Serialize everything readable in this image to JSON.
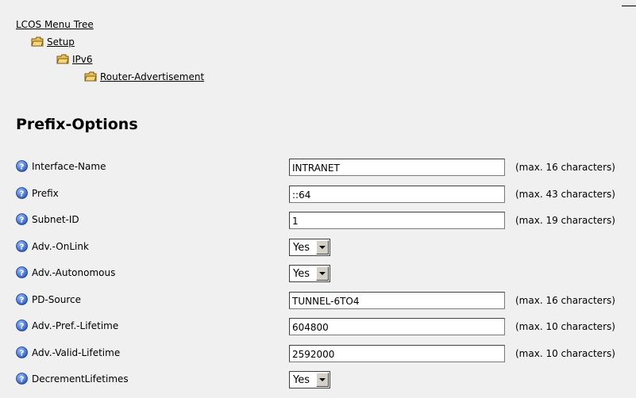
{
  "breadcrumb": {
    "root": "LCOS Menu Tree",
    "items": [
      {
        "label": "Setup",
        "icon": "folder-icon"
      },
      {
        "label": "IPv6",
        "icon": "folder-icon"
      },
      {
        "label": "Router-Advertisement",
        "icon": "folder-icon"
      }
    ]
  },
  "page_title": "Prefix-Options",
  "colors": {
    "background": "#f0f0f0",
    "help_icon": "#3b6fd6",
    "folder_icon": "#e2b94a"
  },
  "fields": [
    {
      "label": "Interface-Name",
      "type": "text",
      "value": "INTRANET",
      "hint": "(max. 16 characters)"
    },
    {
      "label": "Prefix",
      "type": "text",
      "value": "::64",
      "hint": "(max. 43 characters)"
    },
    {
      "label": "Subnet-ID",
      "type": "text",
      "value": "1",
      "hint": "(max. 19 characters)"
    },
    {
      "label": "Adv.-OnLink",
      "type": "select",
      "value": "Yes"
    },
    {
      "label": "Adv.-Autonomous",
      "type": "select",
      "value": "Yes"
    },
    {
      "label": "PD-Source",
      "type": "text",
      "value": "TUNNEL-6TO4",
      "hint": "(max. 16 characters)"
    },
    {
      "label": "Adv.-Pref.-Lifetime",
      "type": "text",
      "value": "604800",
      "hint": "(max. 10 characters)"
    },
    {
      "label": "Adv.-Valid-Lifetime",
      "type": "text",
      "value": "2592000",
      "hint": "(max. 10 characters)"
    },
    {
      "label": "DecrementLifetimes",
      "type": "select",
      "value": "Yes"
    }
  ]
}
